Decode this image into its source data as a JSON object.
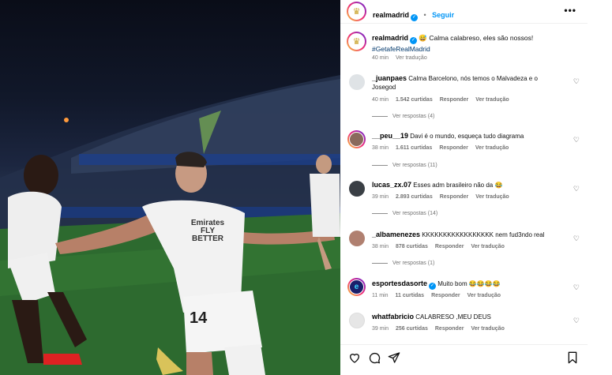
{
  "post": {
    "account": "realmadrid",
    "follow_label": "Seguir",
    "more_icon": "more-horizontal-icon",
    "verified_icon": "verified-badge-icon",
    "caption_emoji": "😅",
    "caption_text": "Calma calabreso, eles são nossos!",
    "hashtag": "#GetafeRealMadrid",
    "time": "40 min",
    "translate_label": "Ver tradução",
    "photo_jersey_text": "Emirates FLY BETTER",
    "photo_number": "14"
  },
  "comments": [
    {
      "user": "_juanpaes",
      "text": "Calma Barcelono, nós temos o Malvadeza e o Josegod",
      "time": "40 min",
      "likes": "1.542 curtidas",
      "reply": "Responder",
      "translate": "Ver tradução",
      "replies": "Ver respostas (4)",
      "avatar_color": "#dfe3e6"
    },
    {
      "user": "__peu__19",
      "text": "Davi é o mundo, esqueça tudo diagrama",
      "time": "38 min",
      "likes": "1.611 curtidas",
      "reply": "Responder",
      "translate": "Ver tradução",
      "replies": "Ver respostas (11)",
      "avatar_color": "#8a6a5c"
    },
    {
      "user": "lucas_zx.07",
      "text": "Esses adm brasileiro não da 😂",
      "time": "39 min",
      "likes": "2.893 curtidas",
      "reply": "Responder",
      "translate": "Ver tradução",
      "replies": "Ver respostas (14)",
      "avatar_color": "#3a3f45"
    },
    {
      "user": "_albamenezes",
      "text": "KKKKKKKKKKKKKKKKK nem fud3ndo real",
      "time": "38 min",
      "likes": "878 curtidas",
      "reply": "Responder",
      "translate": "Ver tradução",
      "replies": "Ver respostas (1)",
      "avatar_color": "#b08070"
    },
    {
      "user": "esportesdasorte",
      "text": "Muito bom 😂😂😂😂",
      "time": "11 min",
      "likes": "11 curtidas",
      "reply": "Responder",
      "translate": "Ver tradução",
      "replies": "",
      "avatar_color": "#1b1f6b"
    },
    {
      "user": "whatfabricio",
      "text": "CALABRESO ,MEU DEUS",
      "time": "39 min",
      "likes": "256 curtidas",
      "reply": "Responder",
      "translate": "Ver tradução",
      "replies": "",
      "avatar_color": "#e6e6e6"
    }
  ],
  "actions": {
    "like_icon": "heart-icon",
    "comment_icon": "comment-icon",
    "share_icon": "send-icon",
    "save_icon": "bookmark-icon"
  },
  "colors": {
    "link_blue": "#0095f6",
    "hashtag_blue": "#00376b",
    "muted": "#737373"
  }
}
